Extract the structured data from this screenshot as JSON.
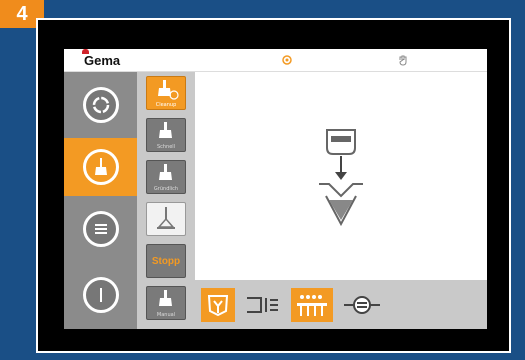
{
  "step_number": "4",
  "header": {
    "brand": "Gema",
    "icons": [
      "settings-icon",
      "hand-icon"
    ]
  },
  "sidebar": {
    "items": [
      {
        "icon": "ring-icon",
        "active": false
      },
      {
        "icon": "brush-icon",
        "active": true
      },
      {
        "icon": "menu-lines-icon",
        "active": false
      },
      {
        "icon": "power-icon",
        "active": false
      }
    ]
  },
  "subbar": {
    "items": [
      {
        "label": "Cleanup",
        "icon": "hopper-clean-icon",
        "active": true
      },
      {
        "label": "Schnell",
        "icon": "brush-fast-icon",
        "active": false
      },
      {
        "label": "Gründlich",
        "icon": "brush-thorough-icon",
        "active": false
      },
      {
        "label": "",
        "icon": "funnel-icon",
        "active": false
      },
      {
        "label": "Stopp",
        "icon": "",
        "active": false
      },
      {
        "label": "Manual",
        "icon": "brush-manual-icon",
        "active": false
      }
    ]
  },
  "bottombar": {
    "items": [
      {
        "icon": "hopper-down-icon",
        "active": true
      },
      {
        "icon": "ejector-icon",
        "active": false
      },
      {
        "icon": "guns-icon",
        "active": true
      },
      {
        "icon": "hose-icon",
        "active": false
      }
    ]
  },
  "colors": {
    "accent": "#f39a23",
    "background": "#1a4f86",
    "sidebar": "#8b8b8b"
  }
}
